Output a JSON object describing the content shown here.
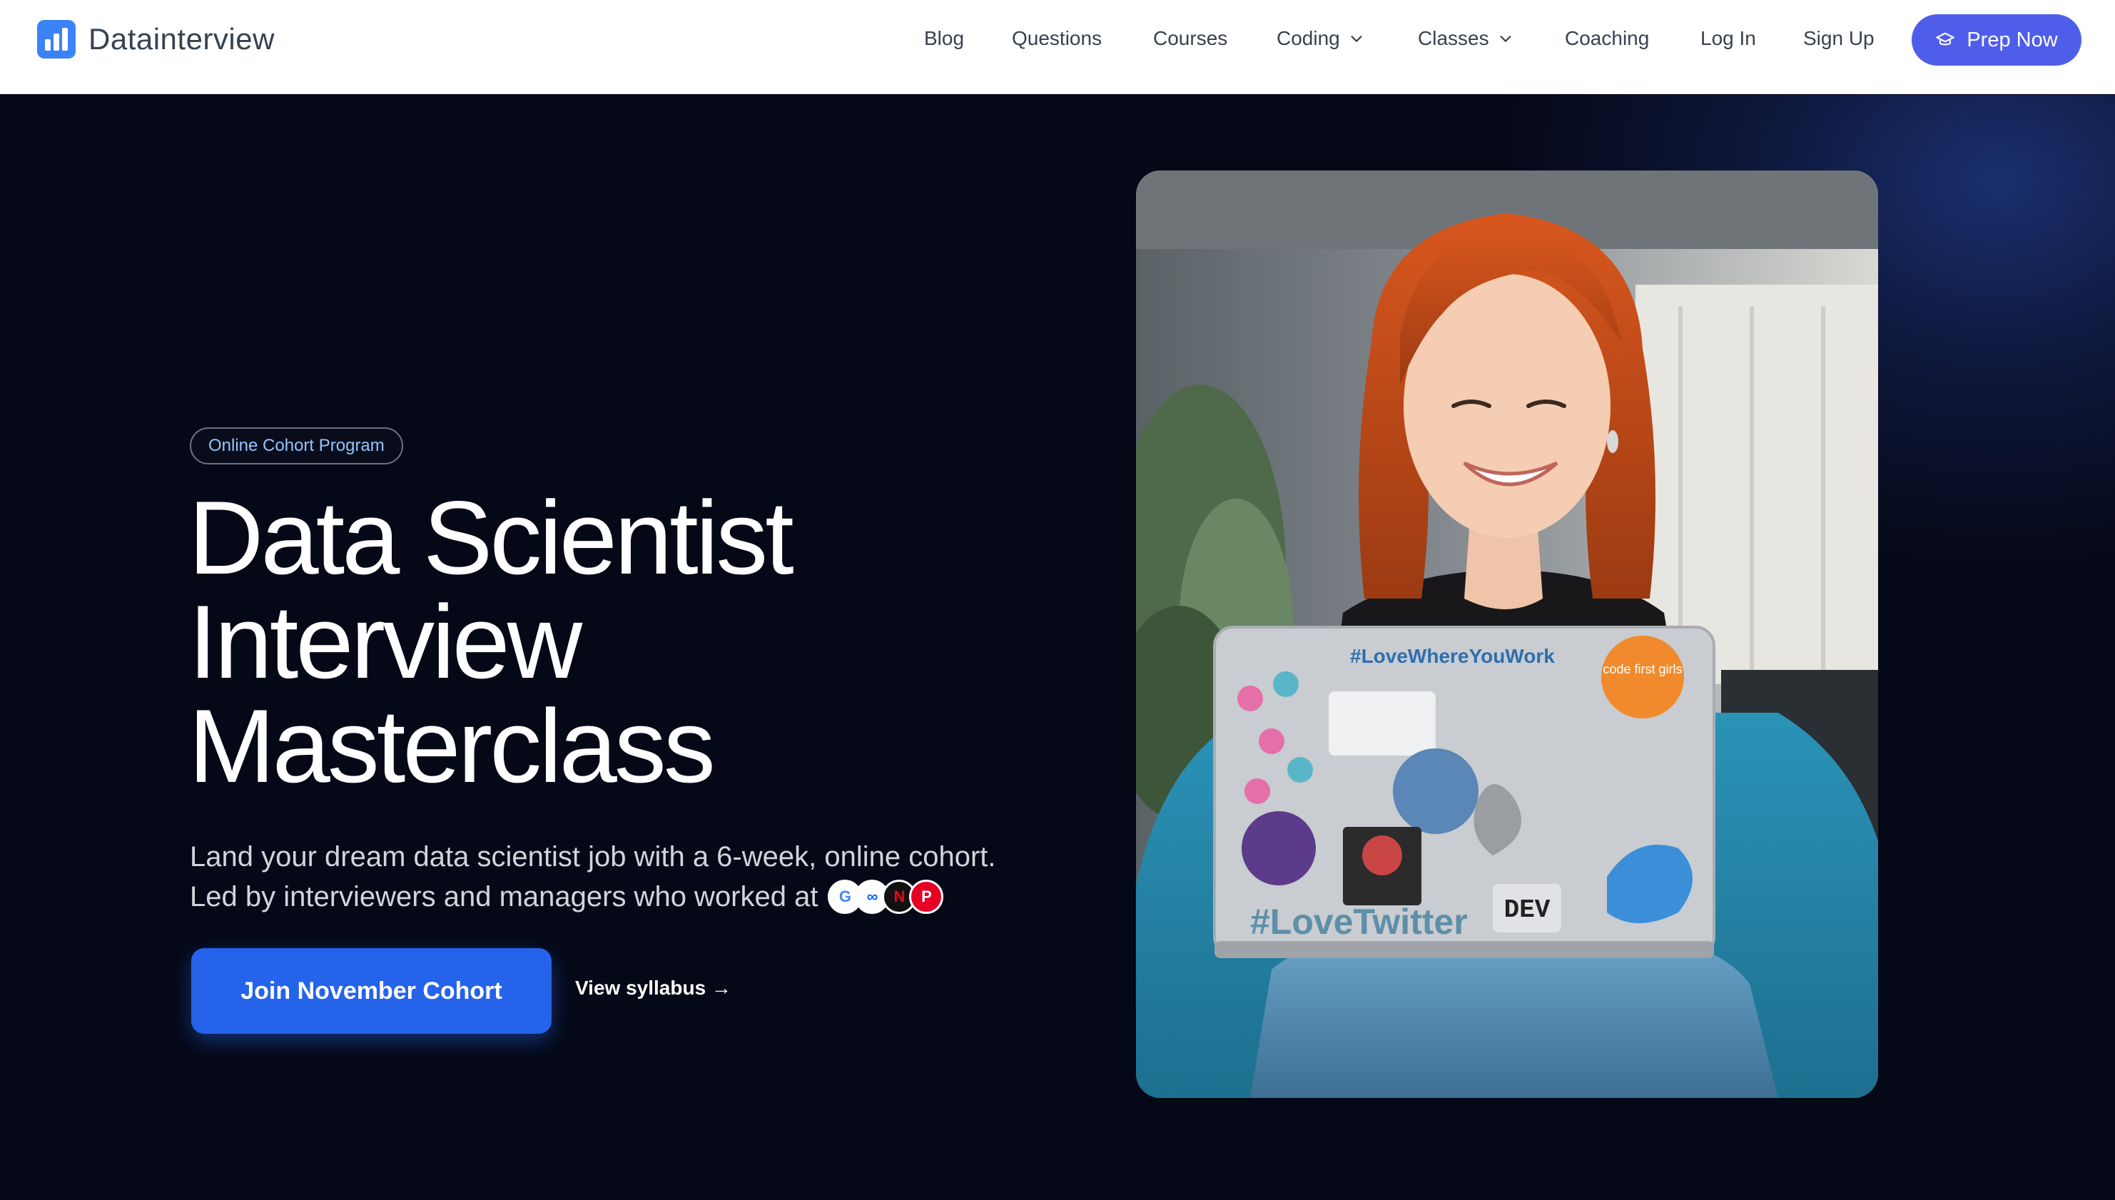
{
  "brand": {
    "name": "Datainterview"
  },
  "nav": {
    "blog": "Blog",
    "questions": "Questions",
    "courses": "Courses",
    "coding": "Coding",
    "classes": "Classes",
    "coaching": "Coaching",
    "login": "Log In",
    "signup": "Sign Up",
    "cta": "Prep Now"
  },
  "hero": {
    "badge": "Online Cohort Program",
    "title_lines": [
      "Data Scientist",
      "Interview",
      "Masterclass"
    ],
    "subtitle_line1": "Land your dream data scientist job with a 6-week, online cohort.",
    "subtitle_line2": "Led by interviewers and managers who worked at",
    "company_logos": [
      "google-icon",
      "meta-icon",
      "netflix-icon",
      "pinterest-icon"
    ],
    "cta": "Join November Cohort",
    "secondary_link": "View syllabus →"
  },
  "photo": {
    "stickers": [
      "#LoveWhereYouWork",
      "#LoveTwitter",
      "DEV",
      "code first girls"
    ]
  },
  "colors": {
    "accent": "#2563eb",
    "nav_cta": "#4f5eea",
    "background": "#050816",
    "badge_text": "#93c5fd"
  }
}
